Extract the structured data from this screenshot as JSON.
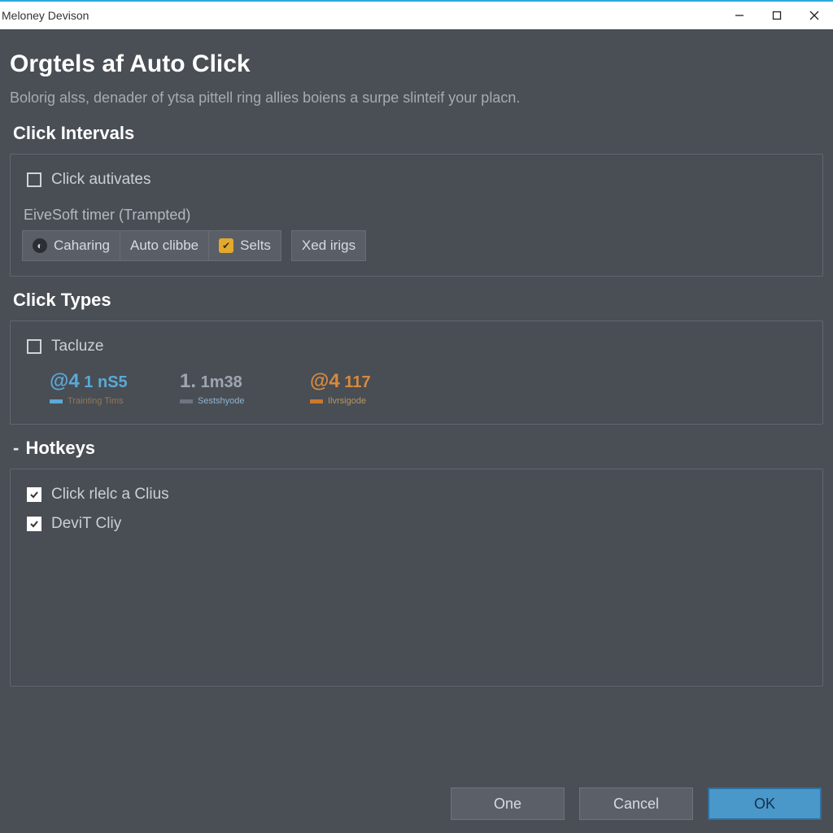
{
  "window": {
    "title": "Meloney Devison"
  },
  "header": {
    "title": "Orgtels af Auto Click",
    "desc": "Bolorig alss, denader of ytsa pittell ring allies boiens a surpe slinteif your placn."
  },
  "intervals": {
    "heading": "Click Intervals",
    "checkbox_label": "Click autivates",
    "checkbox_checked": false,
    "sub_label": "EiveSoft timer (Trampted)",
    "segments": {
      "group1": [
        "Caharing",
        "Auto clibbe",
        "Selts"
      ],
      "group2": [
        "Xed irigs"
      ]
    }
  },
  "types": {
    "heading": "Click Types",
    "checkbox_label": "Tacluze",
    "checkbox_checked": false,
    "stats": [
      {
        "value_big": "@4",
        "value_small": " 1 nS5",
        "caption": "Trainting Tims"
      },
      {
        "value_big": "1.",
        "value_small": " 1m38",
        "caption": "Sestshyode"
      },
      {
        "value_big": "@4",
        "value_small": " 117",
        "caption": "Ilvrsigode"
      }
    ]
  },
  "hotkeys": {
    "heading": "Hotkeys",
    "items": [
      {
        "label": "Click rlelc a Clius",
        "checked": true
      },
      {
        "label": "DeviT Cliy",
        "checked": true
      }
    ]
  },
  "footer": {
    "one": "One",
    "cancel": "Cancel",
    "ok": "OK"
  }
}
